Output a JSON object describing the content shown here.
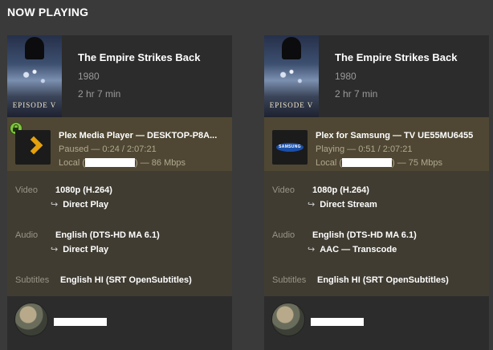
{
  "section_title": "NOW PLAYING",
  "sessions": [
    {
      "movie": {
        "title": "The Empire Strikes Back",
        "year": "1980",
        "duration": "2 hr 7 min",
        "poster_text": "EPISODE V"
      },
      "player": {
        "icon": "plex-chevron-icon",
        "name": "Plex Media Player  —  DESKTOP-P8A...",
        "state": "Paused — 0:24 / 2:07:21",
        "net_prefix": "Local (",
        "net_suffix": ") — 86 Mbps"
      },
      "video": {
        "label": "Video",
        "value": "1080p (H.264)",
        "sub": "Direct Play"
      },
      "audio": {
        "label": "Audio",
        "value": "English (DTS-HD MA 6.1)",
        "sub": "Direct Play"
      },
      "subtitles": {
        "label": "Subtitles",
        "value": "English HI (SRT OpenSubtitles)"
      },
      "secure": true
    },
    {
      "movie": {
        "title": "The Empire Strikes Back",
        "year": "1980",
        "duration": "2 hr 7 min",
        "poster_text": "EPISODE V"
      },
      "player": {
        "icon": "samsung-logo-icon",
        "logo_text": "SAMSUNG",
        "name": "Plex for Samsung  —  TV UE55MU6455",
        "state": "Playing — 0:51 / 2:07:21",
        "net_prefix": "Local (",
        "net_suffix": ") — 75 Mbps"
      },
      "video": {
        "label": "Video",
        "value": "1080p (H.264)",
        "sub": "Direct Stream"
      },
      "audio": {
        "label": "Audio",
        "value": "English (DTS-HD MA 6.1)",
        "sub": "AAC — Transcode"
      },
      "subtitles": {
        "label": "Subtitles",
        "value": "English HI (SRT OpenSubtitles)"
      },
      "secure": false
    }
  ],
  "colors": {
    "background": "#3a3a3a",
    "card": "#323232",
    "player_band": "#4f4733",
    "stream_area": "#403c32",
    "plex_accent": "#e5a00d",
    "secure_badge": "#7fc241"
  }
}
